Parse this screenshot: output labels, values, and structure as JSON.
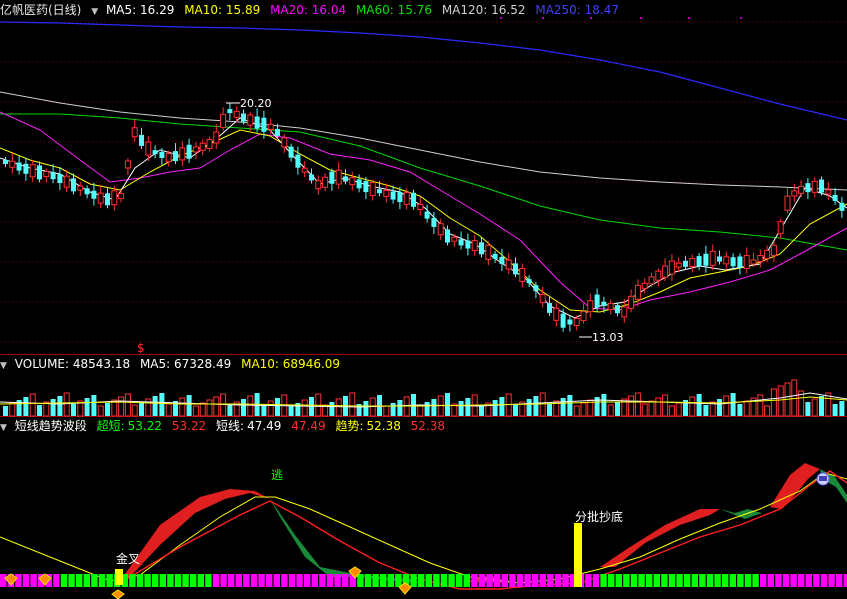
{
  "colors": {
    "up": "#ff3232",
    "down": "#54fcfc",
    "ma5": "#ffffff",
    "ma10": "#ffff00",
    "ma20": "#ff00ff",
    "ma60": "#00ff00",
    "ma120": "#d0d0d0",
    "ma250": "#3030ff",
    "grid": "#8a0000"
  },
  "main_panel": {
    "title": "亿帆医药(日线)",
    "ma5_label": "MA5: 16.29",
    "ma10_label": "MA10: 15.89",
    "ma20_label": "MA20: 16.04",
    "ma60_label": "MA60: 15.76",
    "ma120_label": "MA120: 16.52",
    "ma250_label": "MA250: 18.47",
    "high_label": "20.20",
    "low_label": "13.03",
    "dollar_marker": "$"
  },
  "volume_panel": {
    "title": "VOLUME: 48543.18",
    "ma5_label": "MA5: 67328.49",
    "ma10_label": "MA10: 68946.09"
  },
  "indicator_panel": {
    "title": "短线趋势波段",
    "short_super_label": "超短:",
    "short_super_a": "53.22",
    "short_super_b": "53.22",
    "short_label": "短线:",
    "short_a": "47.49",
    "short_b": "47.49",
    "trend_label": "趋势:",
    "trend_a": "52.38",
    "trend_b": "52.38",
    "escape_label": "逃",
    "golden_cross_label": "金叉",
    "batch_bottom_label": "分批抄底"
  }
}
